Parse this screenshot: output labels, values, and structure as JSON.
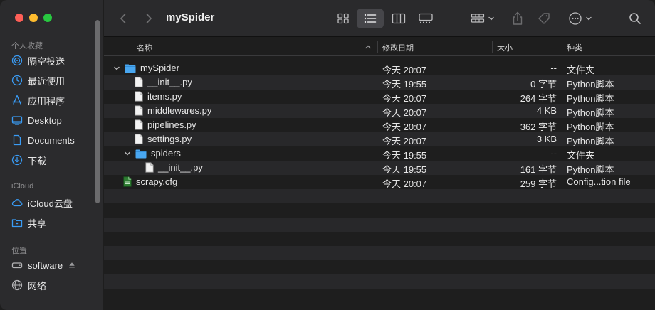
{
  "window": {
    "title": "mySpider"
  },
  "sidebar": {
    "favorites_label": "个人收藏",
    "favorites": [
      {
        "label": "隔空投送",
        "icon": "airdrop-icon"
      },
      {
        "label": "最近使用",
        "icon": "clock-icon"
      },
      {
        "label": "应用程序",
        "icon": "applications-icon"
      },
      {
        "label": "Desktop",
        "icon": "desktop-icon"
      },
      {
        "label": "Documents",
        "icon": "document-icon"
      },
      {
        "label": "下载",
        "icon": "download-icon"
      }
    ],
    "icloud_label": "iCloud",
    "icloud": [
      {
        "label": "iCloud云盘",
        "icon": "cloud-icon"
      },
      {
        "label": "共享",
        "icon": "shared-folder-icon"
      }
    ],
    "locations_label": "位置",
    "locations": [
      {
        "label": "software",
        "icon": "disk-icon"
      },
      {
        "label": "网络",
        "icon": "globe-icon"
      }
    ]
  },
  "columns": {
    "name": "名称",
    "date": "修改日期",
    "size": "大小",
    "kind": "种类"
  },
  "files": [
    {
      "name": "mySpider",
      "date": "今天 20:07",
      "size": "--",
      "kind": "文件夹",
      "type": "folder",
      "indent": 0,
      "expanded": true
    },
    {
      "name": "__init__.py",
      "date": "今天 19:55",
      "size": "0 字节",
      "kind": "Python脚本",
      "type": "file",
      "indent": 1
    },
    {
      "name": "items.py",
      "date": "今天 20:07",
      "size": "264 字节",
      "kind": "Python脚本",
      "type": "file",
      "indent": 1
    },
    {
      "name": "middlewares.py",
      "date": "今天 20:07",
      "size": "4 KB",
      "kind": "Python脚本",
      "type": "file",
      "indent": 1
    },
    {
      "name": "pipelines.py",
      "date": "今天 20:07",
      "size": "362 字节",
      "kind": "Python脚本",
      "type": "file",
      "indent": 1
    },
    {
      "name": "settings.py",
      "date": "今天 20:07",
      "size": "3 KB",
      "kind": "Python脚本",
      "type": "file",
      "indent": 1
    },
    {
      "name": "spiders",
      "date": "今天 19:55",
      "size": "--",
      "kind": "文件夹",
      "type": "folder",
      "indent": 1,
      "expanded": true
    },
    {
      "name": "__init__.py",
      "date": "今天 19:55",
      "size": "161 字节",
      "kind": "Python脚本",
      "type": "file",
      "indent": 2
    },
    {
      "name": "scrapy.cfg",
      "date": "今天 20:07",
      "size": "259 字节",
      "kind": "Config...tion file",
      "type": "cfg",
      "indent": 0
    }
  ],
  "colors": {
    "accent": "#3a9cf5",
    "folder": "#49a7f0"
  }
}
